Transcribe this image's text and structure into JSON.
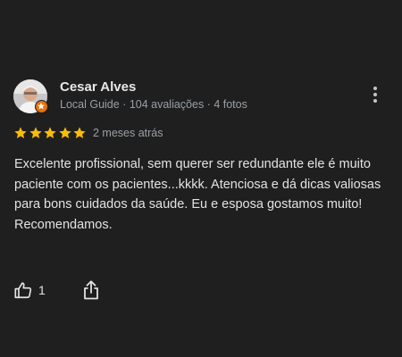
{
  "review": {
    "author": {
      "name": "Cesar Alves",
      "subtitle": "Local Guide · 104 avaliações · 4 fotos"
    },
    "rating": 5,
    "date": "2 meses atrás",
    "text_lines": [
      "Excelente profissional, sem querer ser redundante ele é muito paciente com os pacientes...kkkk. Atenciosa e dá dicas valiosas para bons cuidados da saúde. Eu e esposa gostamos muito!",
      "Recomendamos."
    ],
    "likes": "1",
    "icons": {
      "menu": "more-vert-icon",
      "like": "thumb-up-icon",
      "share": "share-icon",
      "badge": "local-guide-badge-icon",
      "star": "star-icon"
    },
    "colors": {
      "background": "#1f1f1f",
      "star": "#fbbc04",
      "badge": "#e8710a",
      "secondary_text": "#9aa0a6"
    }
  }
}
